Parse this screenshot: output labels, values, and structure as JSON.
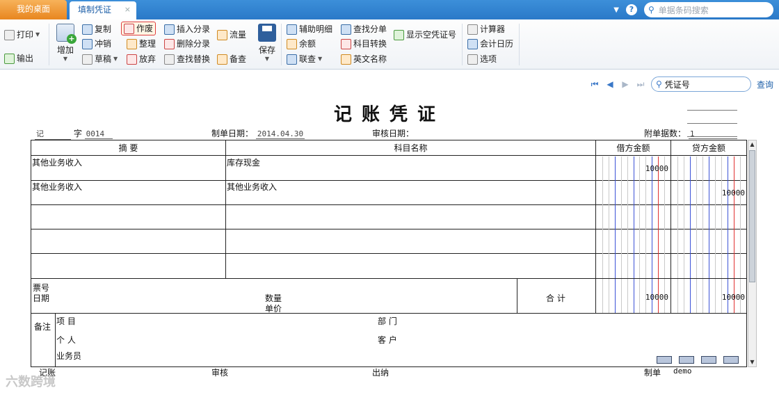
{
  "tabs": {
    "home": "我的桌面",
    "active": "填制凭证",
    "close": "×"
  },
  "top": {
    "barcode_placeholder": "单据条码搜索"
  },
  "toolbar": {
    "print": "打印",
    "output": "输出",
    "add": "增加",
    "copy": "复制",
    "reverse": "冲销",
    "draft": "草稿",
    "void": "作废",
    "tidy": "整理",
    "abandon": "放弃",
    "insert_entry": "插入分录",
    "delete_entry": "删除分录",
    "find_replace": "查找替换",
    "flow": "流量",
    "backup_query": "备查",
    "save": "保存",
    "aux_detail": "辅助明细",
    "balance": "余额",
    "linked_query": "联查",
    "find_entry": "查找分单",
    "account_convert": "科目转换",
    "english_name": "英文名称",
    "show_empty_no": "显示空凭证号",
    "calculator": "计算器",
    "calendar": "会计日历",
    "options": "选项"
  },
  "nav": {
    "search_value": "凭证号",
    "query": "查询"
  },
  "voucher": {
    "title": "记账凭证",
    "type": "记",
    "no_label": "字",
    "no_value": "0014",
    "date_label": "制单日期：",
    "date_value": "2014.04.30",
    "audit_date_label": "审核日期：",
    "attach_label": "附单据数：",
    "attach_value": "1"
  },
  "grid": {
    "headers": {
      "summary": "摘 要",
      "account": "科目名称",
      "debit": "借方金额",
      "credit": "贷方金额"
    },
    "rows": [
      {
        "summary": "其他业务收入",
        "account": "库存现金",
        "debit": "10000",
        "credit": ""
      },
      {
        "summary": "其他业务收入",
        "account": "其他业务收入",
        "debit": "",
        "credit": "10000"
      },
      {
        "summary": "",
        "account": "",
        "debit": "",
        "credit": ""
      },
      {
        "summary": "",
        "account": "",
        "debit": "",
        "credit": ""
      },
      {
        "summary": "",
        "account": "",
        "debit": "",
        "credit": ""
      }
    ],
    "ticket_no": "票号",
    "ticket_date": "日期",
    "quantity": "数量",
    "unit_price": "单价",
    "total_label": "合 计",
    "total_debit": "10000",
    "total_credit": "10000",
    "remark": "备注",
    "project": "项  目",
    "department": "部  门",
    "person": "个  人",
    "customer": "客  户",
    "salesman": "业务员"
  },
  "footer": {
    "bookkeeper": "记账",
    "auditor": "审核",
    "cashier": "出纳",
    "maker_label": "制单",
    "maker": "demo"
  },
  "watermark": "六数跨境"
}
